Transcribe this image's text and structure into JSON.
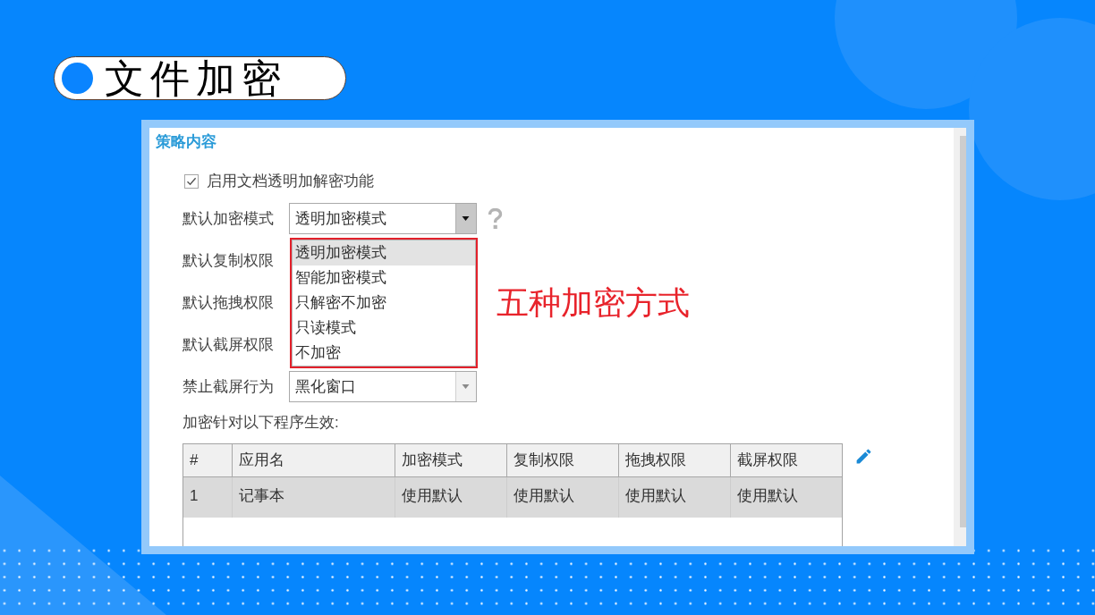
{
  "title": "文件加密",
  "panel": {
    "section_title": "策略内容",
    "enable_option": {
      "label": "启用文档透明加解密功能",
      "checked": true
    },
    "fields": [
      {
        "label": "默认加密模式",
        "kind": "select",
        "value": "透明加密模式",
        "expanded": true,
        "help": true,
        "annotation": "五种加密方式",
        "options": [
          {
            "label": "透明加密模式",
            "selected": true
          },
          {
            "label": "智能加密模式",
            "selected": false
          },
          {
            "label": "只解密不加密",
            "selected": false
          },
          {
            "label": "只读模式",
            "selected": false
          },
          {
            "label": "不加密",
            "selected": false
          }
        ]
      },
      {
        "label": "默认复制权限",
        "kind": "label",
        "help": false
      },
      {
        "label": "默认拖拽权限",
        "kind": "label",
        "help": false
      },
      {
        "label": "默认截屏权限",
        "kind": "label",
        "help": false
      },
      {
        "label": "禁止截屏行为",
        "kind": "select",
        "value": "黑化窗口",
        "expanded": false,
        "help": false
      }
    ],
    "table": {
      "caption": "加密针对以下程序生效:",
      "columns": [
        "#",
        "应用名",
        "加密模式",
        "复制权限",
        "拖拽权限",
        "截屏权限"
      ],
      "rows": [
        {
          "cells": [
            "1",
            "记事本",
            "使用默认",
            "使用默认",
            "使用默认",
            "使用默认"
          ],
          "selected": true
        }
      ]
    }
  }
}
